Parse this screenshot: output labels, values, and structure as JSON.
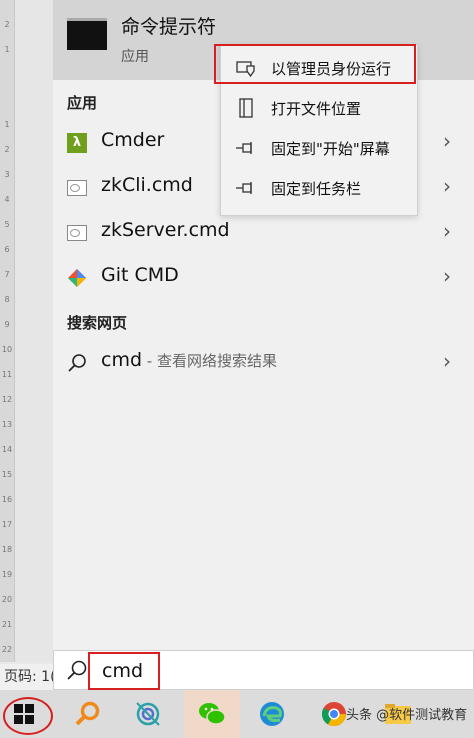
{
  "ruler": {
    "ticks": [
      "2",
      "1",
      "",
      "1",
      "2",
      "3",
      "4",
      "5",
      "6",
      "7",
      "8",
      "9",
      "10",
      "11",
      "12",
      "13",
      "14",
      "15",
      "16",
      "17",
      "18",
      "19",
      "20",
      "21",
      "22"
    ]
  },
  "status": {
    "page_label": "页码: 1("
  },
  "best_match": {
    "title": "命令提示符",
    "subtitle": "应用"
  },
  "sections": {
    "apps": "应用",
    "web": "搜索网页"
  },
  "apps": [
    {
      "label": "Cmder",
      "icon": "lambda-icon"
    },
    {
      "label": "zkCli.cmd",
      "icon": "cmd-file-icon"
    },
    {
      "label": "zkServer.cmd",
      "icon": "cmd-file-icon"
    },
    {
      "label": "Git CMD",
      "icon": "git-icon"
    }
  ],
  "web_result": {
    "query": "cmd",
    "suffix": " - 查看网络搜索结果"
  },
  "context_menu": [
    {
      "label": "以管理员身份运行",
      "icon": "shield-icon"
    },
    {
      "label": "打开文件位置",
      "icon": "folder-open-icon"
    },
    {
      "label": "固定到\"开始\"屏幕",
      "icon": "pin-icon"
    },
    {
      "label": "固定到任务栏",
      "icon": "pin-icon"
    }
  ],
  "search": {
    "value": "cmd"
  },
  "watermark": "头条 @软件测试教育",
  "colors": {
    "highlight": "#d62020",
    "panel": "#f0f0f0",
    "best_match_bg": "#d4d4d4"
  }
}
